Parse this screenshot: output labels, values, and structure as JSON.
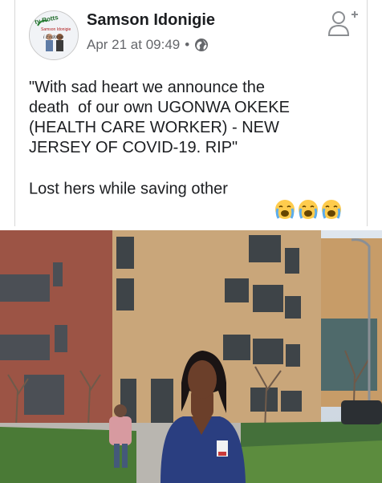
{
  "post": {
    "author": "Samson Idonigie",
    "timestamp": "Apr 21 at 09:49",
    "separator": "•",
    "privacy_icon": "globe-icon",
    "avatar": {
      "line1": "ty Rotts",
      "line2": "Samson Idonigie",
      "line3": "i Endorse"
    },
    "text_lines": [
      "\"With sad heart we announce the",
      "death  of our own UGONWA OKEKE",
      "(HEALTH CARE WORKER) - NEW",
      "JERSEY OF COVID-19. RIP\""
    ],
    "last_line": "Lost hers while saving other",
    "emojis": [
      "loudly-crying-face",
      "loudly-crying-face",
      "loudly-crying-face"
    ]
  },
  "header": {
    "add_friend_icon": "add-friend-icon"
  },
  "photo": {
    "description_icon": "hospital-photo"
  },
  "colors": {
    "text": "#1c1e21",
    "meta": "#65676b",
    "brick": "#9c5445",
    "sand_brick": "#c9a67a",
    "scrubs": "#2a3e80",
    "grass": "#4a7a36"
  }
}
